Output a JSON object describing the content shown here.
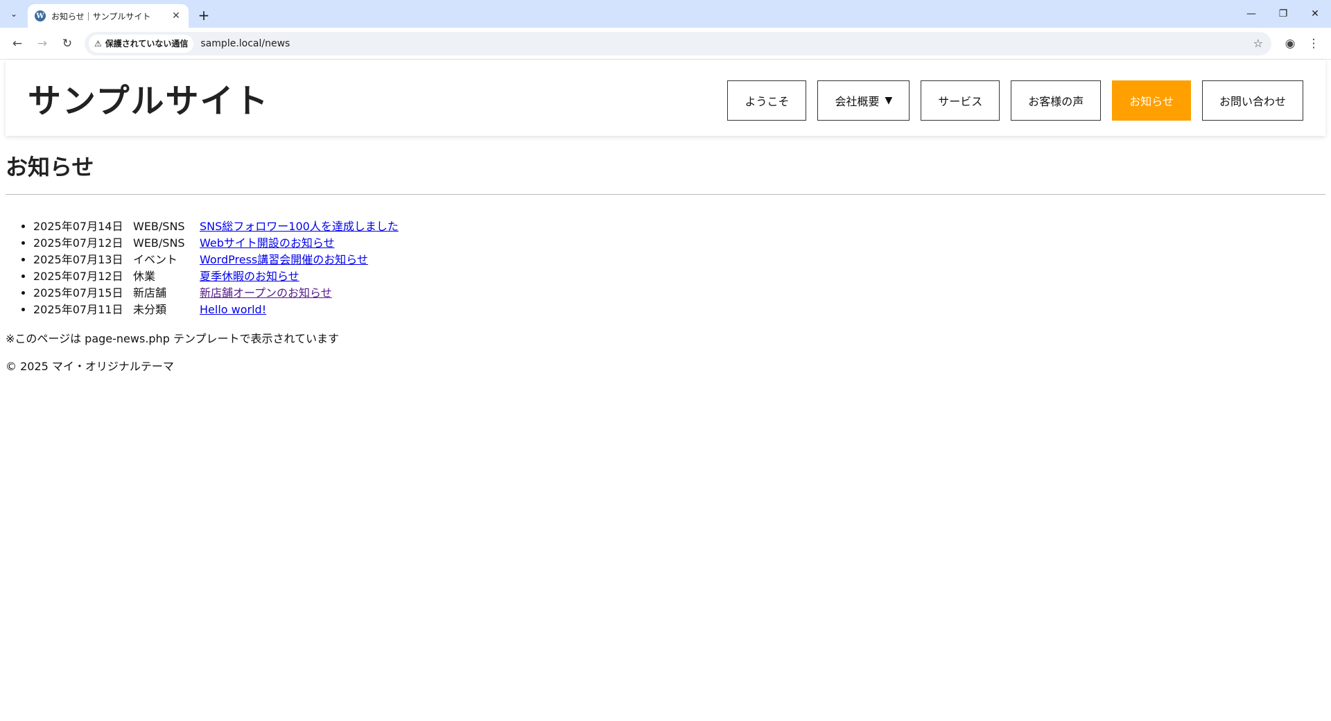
{
  "browser": {
    "tab_title": "お知らせ｜サンプルサイト",
    "security_label": "保護されていない通信",
    "url": "sample.local/news"
  },
  "site": {
    "title": "サンプルサイト",
    "nav": [
      {
        "label": "ようこそ"
      },
      {
        "label": "会社概要"
      },
      {
        "label": "サービス"
      },
      {
        "label": "お客様の声"
      },
      {
        "label": "お知らせ"
      },
      {
        "label": "お問い合わせ"
      }
    ],
    "nav_caret": "▼",
    "accent_color": "#ff9f00"
  },
  "main": {
    "heading": "お知らせ",
    "news": [
      {
        "date": "2025年07月14日",
        "category": "WEB/SNS",
        "title": "SNS総フォロワー100人を達成しました"
      },
      {
        "date": "2025年07月12日",
        "category": "WEB/SNS",
        "title": "Webサイト開設のお知らせ"
      },
      {
        "date": "2025年07月13日",
        "category": "イベント",
        "title": "WordPress講習会開催のお知らせ"
      },
      {
        "date": "2025年07月12日",
        "category": "休業",
        "title": "夏季休暇のお知らせ"
      },
      {
        "date": "2025年07月15日",
        "category": "新店舗",
        "title": "新店舗オープンのお知らせ"
      },
      {
        "date": "2025年07月11日",
        "category": "未分類",
        "title": "Hello world!"
      }
    ],
    "note": "※このページは page-news.php テンプレートで表示されています"
  },
  "footer": {
    "copyright": "© 2025 マイ・オリジナルテーマ"
  }
}
